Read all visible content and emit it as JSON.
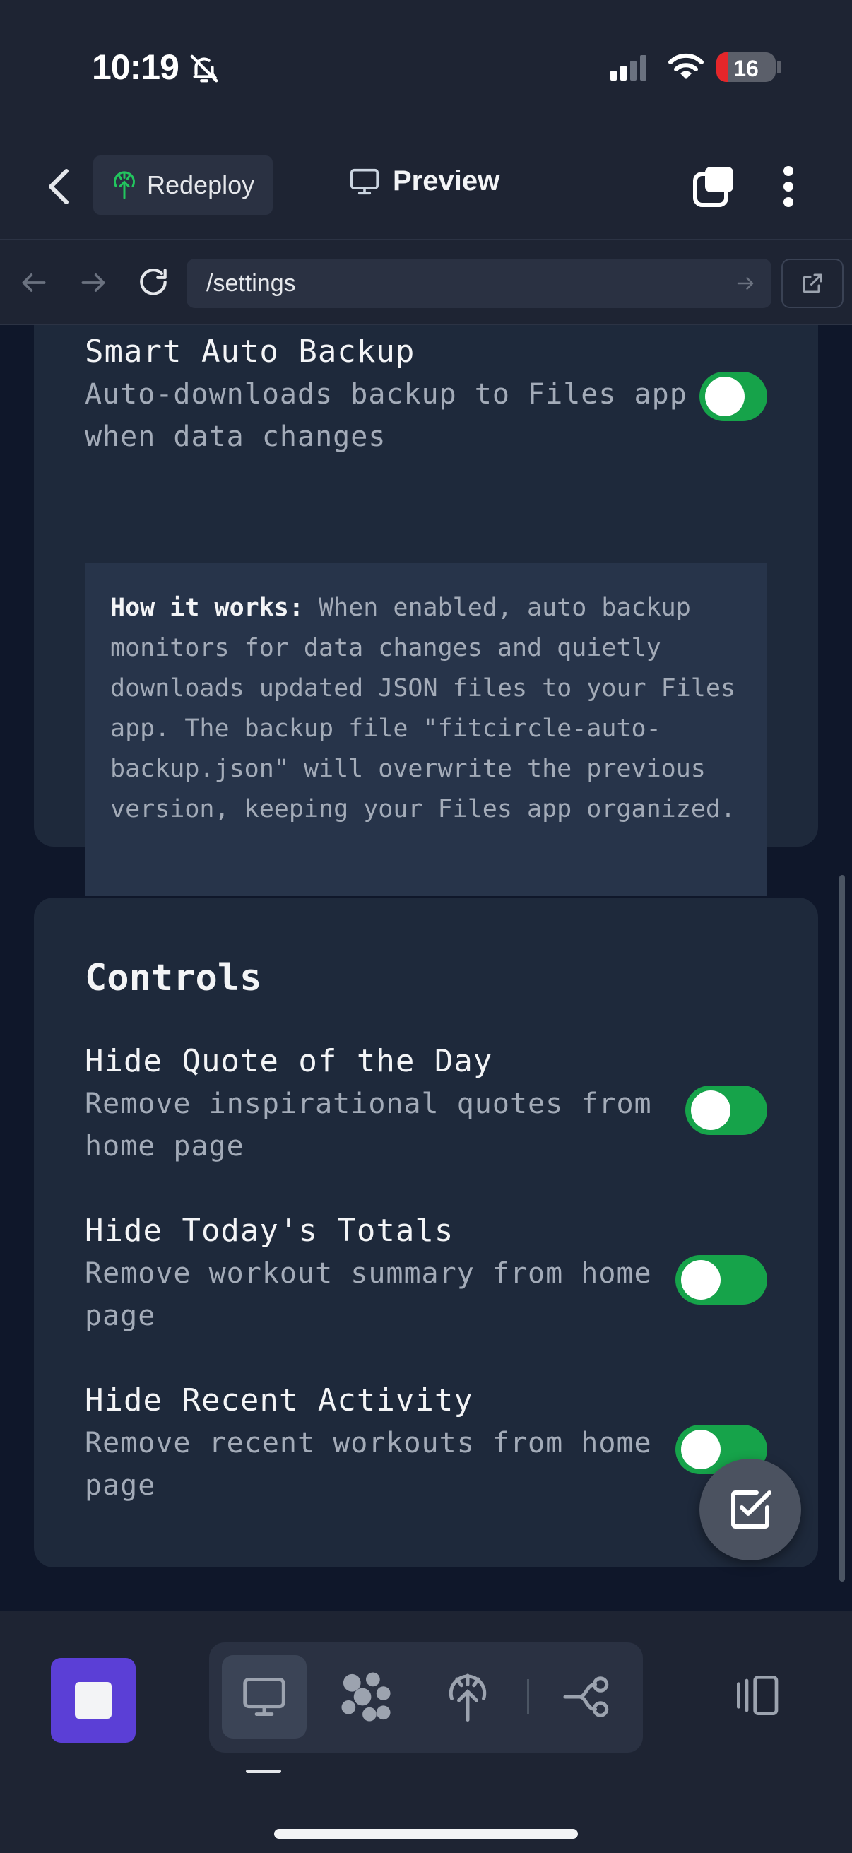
{
  "status_bar": {
    "time": "10:19",
    "battery": "16"
  },
  "header": {
    "redeploy_label": "Redeploy",
    "preview_label": "Preview"
  },
  "url_bar": {
    "url": "/settings"
  },
  "backup": {
    "title_partial": "Smart Auto Backup",
    "description": "Auto-downloads backup to Files app when data changes",
    "enabled": true,
    "info_bold": "How it works:",
    "info_text": " When enabled, auto backup monitors for data changes and quietly downloads updated JSON files to your Files app. The backup file \"fitcircle-auto-backup.json\" will overwrite the previous version, keeping your Files app organized."
  },
  "controls": {
    "title": "Controls",
    "items": [
      {
        "title": "Hide Quote of the Day",
        "description": "Remove inspirational quotes from home page",
        "enabled": true
      },
      {
        "title": "Hide Today's Totals",
        "description": "Remove workout summary from home page",
        "enabled": true
      },
      {
        "title": "Hide Recent Activity",
        "description": "Remove recent workouts from home page",
        "enabled": true
      }
    ]
  },
  "colors": {
    "toggle_on": "#16a34a",
    "stop_button": "#5b3fd6",
    "card": "#1e293b",
    "background": "#0f172a"
  },
  "icons": [
    "bell-slash-icon",
    "signal-icon",
    "wifi-icon",
    "back-icon",
    "redeploy-icon",
    "monitor-icon",
    "tabs-icon",
    "more-icon",
    "nav-back-icon",
    "nav-forward-icon",
    "reload-icon",
    "go-arrow-icon",
    "external-link-icon",
    "checkbox-icon",
    "stop-icon",
    "preview-mode-icon",
    "grid-icon",
    "deploy-icon",
    "git-icon",
    "panel-icon"
  ]
}
